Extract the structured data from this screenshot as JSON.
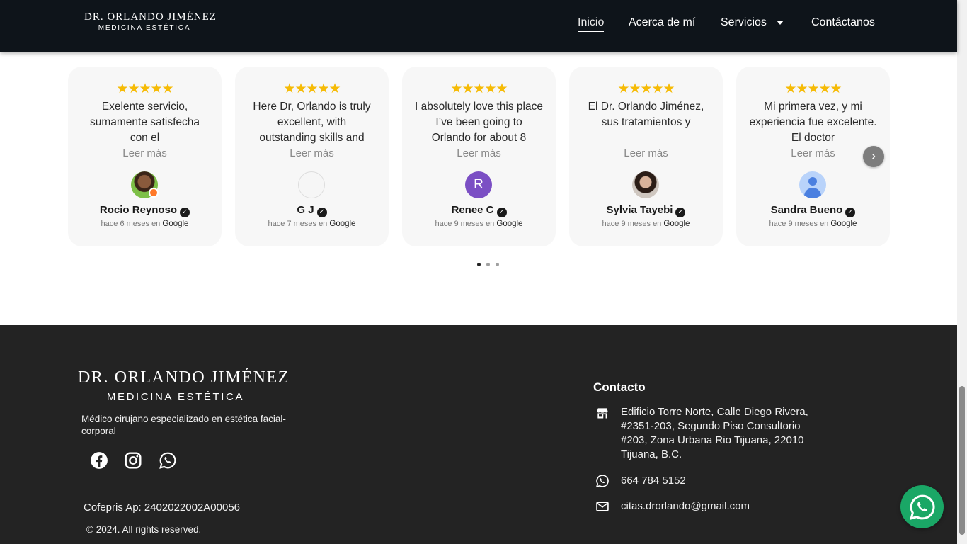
{
  "header": {
    "logo_line1": "DR. ORLANDO JIMÉNEZ",
    "logo_line2": "MEDICINA  ESTÉTICA",
    "nav": [
      {
        "label": "Inicio",
        "active": true
      },
      {
        "label": "Acerca de mí"
      },
      {
        "label": "Servicios"
      },
      {
        "label": "Contáctanos"
      }
    ]
  },
  "reviews": {
    "stars": "★★★★★",
    "rating": 5,
    "read_more": "Leer más",
    "source": "Google",
    "items": [
      {
        "text": "Exelente servicio, sumamente satisfecha con el",
        "name": "Rocio Reynoso",
        "time": "hace 6 meses en",
        "avatar": "photo"
      },
      {
        "text": "Here Dr, Orlando is truly excellent, with outstanding skills and",
        "name": "G J",
        "time": "hace 7 meses en",
        "avatar": "empty"
      },
      {
        "text": "I absolutely love this place I’ve been going to Orlando for about 8",
        "name": "Renee C",
        "time": "hace 9 meses en",
        "avatar": "R"
      },
      {
        "text": "El Dr. Orlando Jiménez, sus tratamientos y",
        "name": "Sylvia Tayebi",
        "time": "hace 9 meses en",
        "avatar": "photo"
      },
      {
        "text": "Mi primera vez, y mi experiencia fue excelente. El doctor",
        "name": "Sandra Bueno",
        "time": "hace 9 meses en",
        "avatar": "generic"
      }
    ],
    "pagination": {
      "pages": 3,
      "active": 1
    }
  },
  "footer": {
    "logo_line1": "DR. ORLANDO JIMÉNEZ",
    "logo_line2": "MEDICINA  ESTÉTICA",
    "description": "Médico cirujano especializado en estética facial-corporal",
    "social": [
      "facebook-icon",
      "instagram-icon",
      "whatsapp-icon"
    ],
    "cofepris": "Cofepris Ap: 2402022002A00056",
    "copyright": "© 2024. All rights reserved.",
    "contact": {
      "title": "Contacto",
      "address": "Edificio Torre Norte, Calle Diego Rivera, #2351-203, Segundo Piso Consultorio #203, Zona Urbana Rio Tijuana, 22010 Tijuana, B.C.",
      "phone": "664 784 5152",
      "email": "citas.drorlando@gmail.com"
    }
  },
  "colors": {
    "header_bg": "#0e141a",
    "footer_bg": "#232323",
    "star": "#f6bb06",
    "whatsapp": "#1aa766"
  }
}
